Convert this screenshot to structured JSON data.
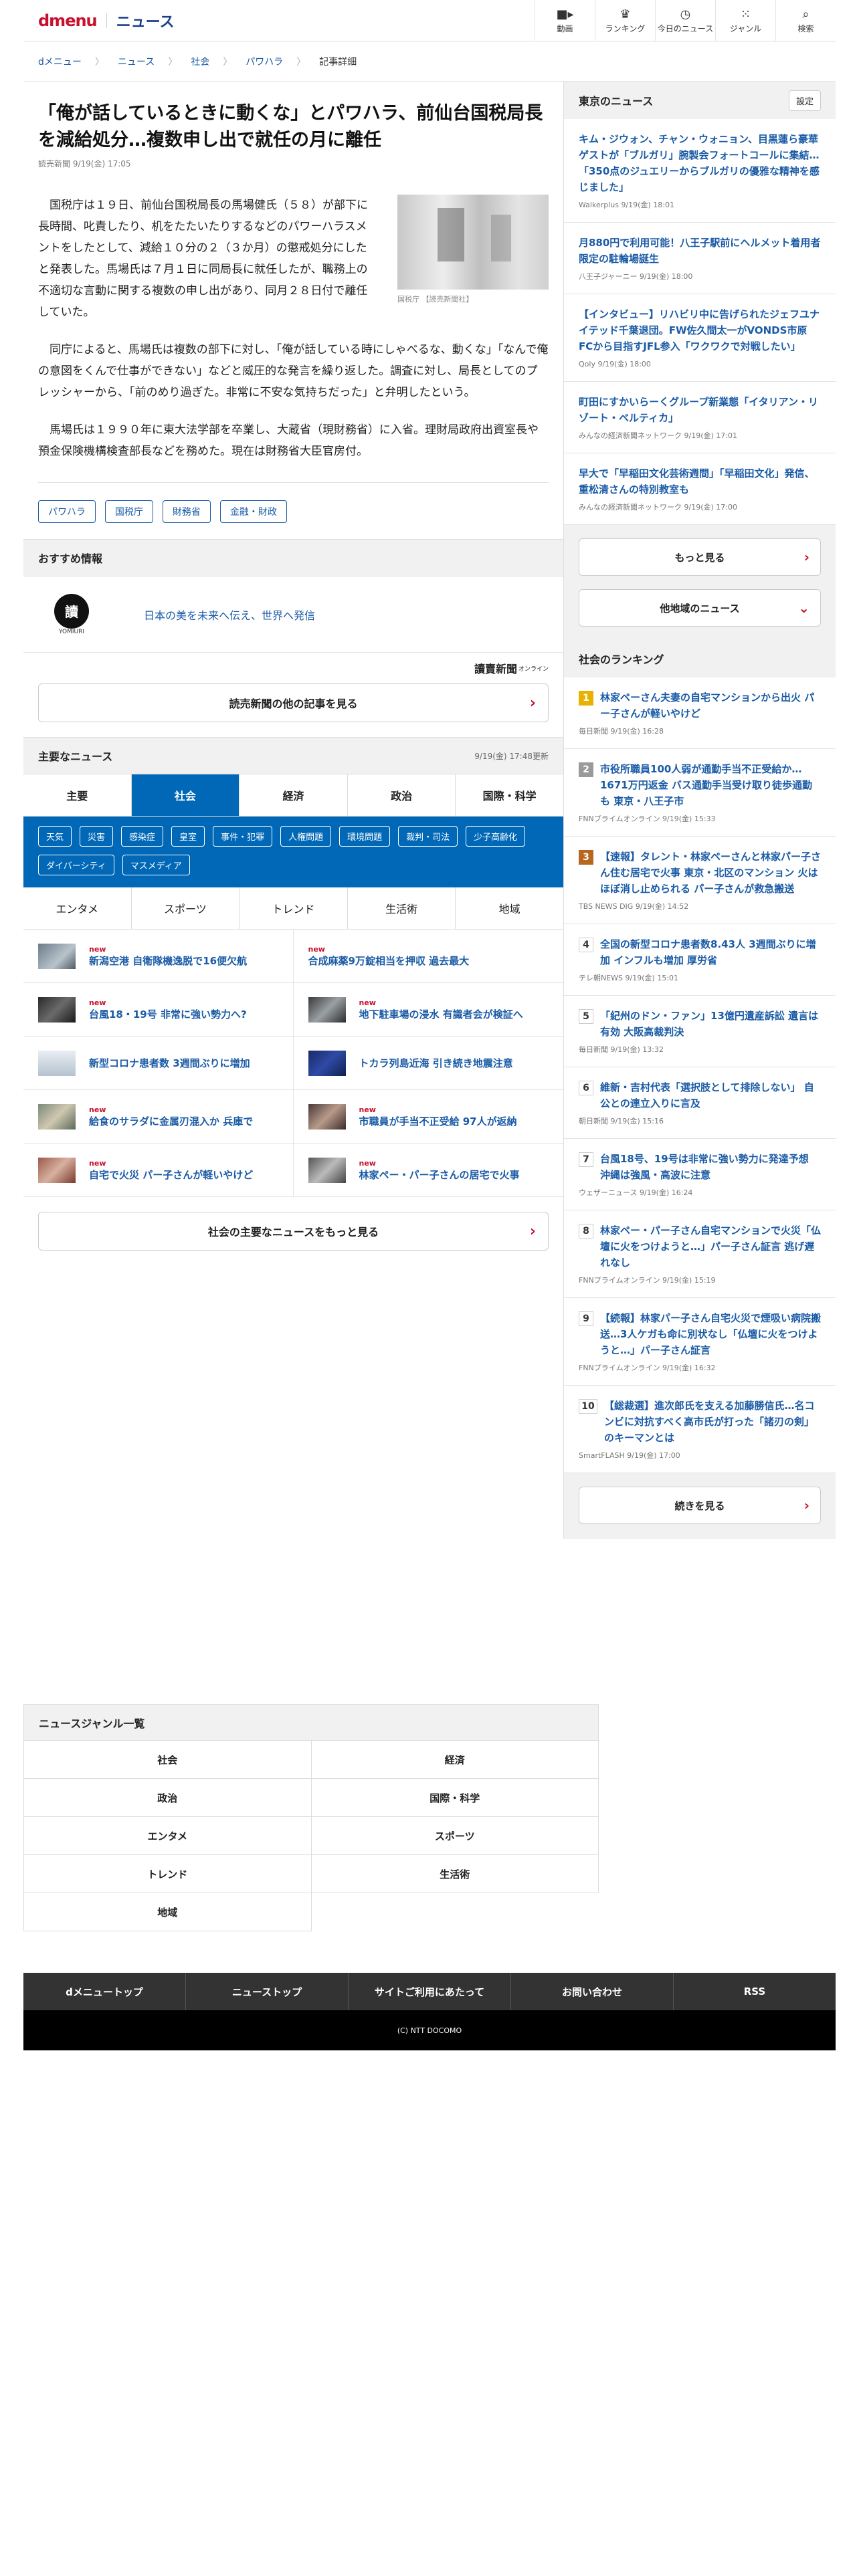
{
  "header": {
    "logo": "dmenu",
    "section": "ニュース",
    "nav": [
      {
        "label": "動画",
        "icon": "video-icon"
      },
      {
        "label": "ランキング",
        "icon": "trophy-icon"
      },
      {
        "label": "今日のニュース",
        "icon": "clock-icon"
      },
      {
        "label": "ジャンル",
        "icon": "grid-icon"
      },
      {
        "label": "検索",
        "icon": "search-icon"
      }
    ]
  },
  "breadcrumb": [
    "dメニュー",
    "ニュース",
    "社会",
    "パワハラ",
    "記事詳細"
  ],
  "article": {
    "title": "「俺が話しているときに動くな」とパワハラ、前仙台国税局長を減給処分…複数申し出で就任の月に離任",
    "meta": "読売新聞 9/19(金) 17:05",
    "photo_caption": "国税庁 【読売新聞社】",
    "paragraphs": [
      "国税庁は１９日、前仙台国税局長の馬場健氏（５８）が部下に長時間、叱責したり、机をたたいたりするなどのパワーハラスメントをしたとして、減給１０分の２（３か月）の懲戒処分にしたと発表した。馬場氏は７月１日に同局長に就任したが、職務上の不適切な言動に関する複数の申し出があり、同月２８日付で離任していた。",
      "同庁によると、馬場氏は複数の部下に対し、「俺が話している時にしゃべるな、動くな」「なんで俺の意図をくんで仕事ができない」などと威圧的な発言を繰り返した。調査に対し、局長としてのプレッシャーから、「前のめり過ぎた。非常に不安な気持ちだった」と弁明したという。",
      "馬場氏は１９９０年に東大法学部を卒業し、大蔵省（現財務省）に入省。理財局政府出資室長や預金保険機構検査部長などを務めた。現在は財務省大臣官房付。"
    ],
    "tags": [
      "パワハラ",
      "国税庁",
      "財務省",
      "金融・財政"
    ]
  },
  "recommend": {
    "heading": "おすすめ情報",
    "logo_text": "YOMIURI",
    "text": "日本の美を未来へ伝え、世界へ発信",
    "publisher": "讀賣新聞",
    "publisher_suffix": "オンライン",
    "more": "読売新聞の他の記事を見る"
  },
  "main_news": {
    "heading": "主要なニュース",
    "updated": "9/19(金) 17:48更新",
    "tabs": [
      "主要",
      "社会",
      "経済",
      "政治",
      "国際・科学"
    ],
    "active_tab": "社会",
    "chips": [
      "天気",
      "災害",
      "感染症",
      "皇室",
      "事件・犯罪",
      "人権問題",
      "環境問題",
      "裁判・司法",
      "少子高齢化",
      "ダイバーシティ",
      "マスメディア"
    ],
    "tabs2": [
      "エンタメ",
      "スポーツ",
      "トレンド",
      "生活術",
      "地域"
    ],
    "new_label": "new",
    "items": [
      {
        "title": "新潟空港 自衛隊機逸脱で16便欠航",
        "new": true
      },
      {
        "title": "合成麻薬9万錠相当を押収 過去最大",
        "new": true
      },
      {
        "title": "台風18・19号 非常に強い勢力へ?",
        "new": true
      },
      {
        "title": "地下駐車場の浸水 有識者会が検証へ",
        "new": true
      },
      {
        "title": "新型コロナ患者数 3週間ぶりに増加",
        "new": false
      },
      {
        "title": "トカラ列島近海 引き続き地震注意",
        "new": false
      },
      {
        "title": "給食のサラダに金属刃混入か 兵庫で",
        "new": true
      },
      {
        "title": "市職員が手当不正受給 97人が返納",
        "new": true
      },
      {
        "title": "自宅で火災 パー子さんが軽いやけど",
        "new": true
      },
      {
        "title": "林家ペー・パー子さんの居宅で火事",
        "new": true
      }
    ],
    "more": "社会の主要なニュースをもっと見る"
  },
  "tokyo_news": {
    "heading": "東京のニュース",
    "settings": "設定",
    "items": [
      {
        "title": "キム・ジウォン、チャン・ウォニョン、目黒蓮ら豪華ゲストが「ブルガリ」腕製会フォートコールに集結…「350点のジュエリーからブルガリの優雅な精神を感じました」",
        "meta": "Walkerplus 9/19(金) 18:01"
      },
      {
        "title": "月880円で利用可能！八王子駅前にヘルメット着用者限定の駐輪場誕生",
        "meta": "八王子ジャーニー 9/19(金) 18:00"
      },
      {
        "title": "【インタビュー】リハビリ中に告げられたジェフユナイテッド千葉退団。FW佐久間太一がVONDS市原FCから目指すJFL参入「ワクワクで対戦したい」",
        "meta": "Qoly 9/19(金) 18:00"
      },
      {
        "title": "町田にすかいらーくグループ新業態「イタリアン・リゾート・ベルティカ」",
        "meta": "みんなの経済新聞ネットワーク 9/19(金) 17:01"
      },
      {
        "title": "早大で「早稲田文化芸術週間」「早稲田文化」発信、重松清さんの特別教室も",
        "meta": "みんなの経済新聞ネットワーク 9/19(金) 17:00"
      }
    ],
    "more": "もっと見る",
    "other": "他地域のニュース"
  },
  "ranking": {
    "heading": "社会のランキング",
    "items": [
      {
        "no": "1",
        "title": "林家ペーさん夫妻の自宅マンションから出火 パー子さんが軽いやけど",
        "meta": "毎日新聞 9/19(金) 16:28"
      },
      {
        "no": "2",
        "title": "市役所職員100人弱が通勤手当不正受給か…1671万円返金 バス通勤手当受け取り徒歩通勤も 東京・八王子市",
        "meta": "FNNプライムオンライン 9/19(金) 15:33"
      },
      {
        "no": "3",
        "title": "【速報】タレント・林家ペーさんと林家パー子さん住む居宅で火事 東京・北区のマンション 火はほぼ消し止められる パー子さんが救急搬送",
        "meta": "TBS NEWS DIG 9/19(金) 14:52"
      },
      {
        "no": "4",
        "title": "全国の新型コロナ患者数8.43人 3週間ぶりに増加 インフルも増加 厚労省",
        "meta": "テレ朝NEWS 9/19(金) 15:01"
      },
      {
        "no": "5",
        "title": "「紀州のドン・ファン」13億円遺産訴訟 遺言は有効 大阪高裁判決",
        "meta": "毎日新聞 9/19(金) 13:32"
      },
      {
        "no": "6",
        "title": "維新・吉村代表「選択肢として排除しない」 自公との連立入りに言及",
        "meta": "朝日新聞 9/19(金) 15:16"
      },
      {
        "no": "7",
        "title": "台風18号、19号は非常に強い勢力に発達予想 沖縄は強風・高波に注意",
        "meta": "ウェザーニュース 9/19(金) 16:24"
      },
      {
        "no": "8",
        "title": "林家ペー・パー子さん自宅マンションで火災「仏壇に火をつけようと…」パー子さん証言 逃げ遅れなし",
        "meta": "FNNプライムオンライン 9/19(金) 15:19"
      },
      {
        "no": "9",
        "title": "【続報】林家パー子さん自宅火災で煙吸い病院搬送…3人ケガも命に別状なし「仏壇に火をつけようと…」パー子さん証言",
        "meta": "FNNプライムオンライン 9/19(金) 16:32"
      },
      {
        "no": "10",
        "title": "【総裁選】進次郎氏を支える加藤勝信氏…名コンビに対抗すべく高市氏が打った「諸刃の剣」のキーマンとは",
        "meta": "SmartFLASH 9/19(金) 17:00"
      }
    ],
    "more": "続きを見る"
  },
  "genre": {
    "heading": "ニュースジャンル一覧",
    "items": [
      "社会",
      "経済",
      "政治",
      "国際・科学",
      "エンタメ",
      "スポーツ",
      "トレンド",
      "生活術",
      "地域"
    ]
  },
  "footer": {
    "links": [
      "dメニュートップ",
      "ニューストップ",
      "サイトご利用にあたって",
      "お問い合わせ",
      "RSS"
    ],
    "copyright": "(C) NTT DOCOMO"
  }
}
